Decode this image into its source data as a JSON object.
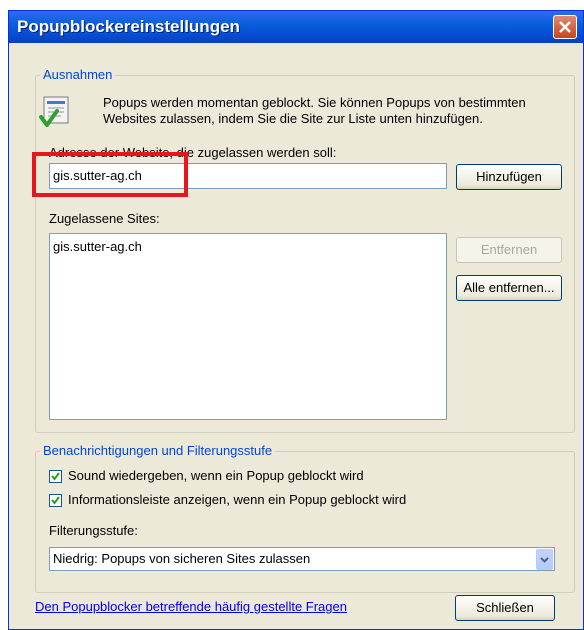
{
  "window": {
    "title": "Popupblockereinstellungen"
  },
  "exceptions": {
    "legend": "Ausnahmen",
    "info_line1": "Popups werden momentan geblockt. Sie können Popups von bestimmten",
    "info_line2": "Websites zulassen, indem Sie die Site zur Liste unten hinzufügen.",
    "address_label": "Adresse der Website, die zugelassen werden soll:",
    "address_value": "gis.sutter-ag.ch",
    "add_button": "Hinzufügen",
    "allowed_label": "Zugelassene Sites:",
    "allowed_sites": [
      "gis.sutter-ag.ch"
    ],
    "remove_button": "Entfernen",
    "remove_all_button": "Alle entfernen..."
  },
  "notifications": {
    "legend": "Benachrichtigungen und Filterungsstufe",
    "sound_label": "Sound wiedergeben, wenn ein Popup geblockt wird",
    "sound_checked": true,
    "infobar_label": "Informationsleiste anzeigen, wenn ein Popup geblockt wird",
    "infobar_checked": true,
    "filter_label": "Filterungsstufe:",
    "filter_value": "Niedrig: Popups von sicheren Sites zulassen"
  },
  "footer": {
    "faq_link": "Den Popupblocker betreffende häufig gestellte Fragen",
    "close_button": "Schließen"
  },
  "colors": {
    "titlebar": "#0a5fdc",
    "highlight_frame": "#e8161b",
    "legend_text": "#0046d5"
  }
}
